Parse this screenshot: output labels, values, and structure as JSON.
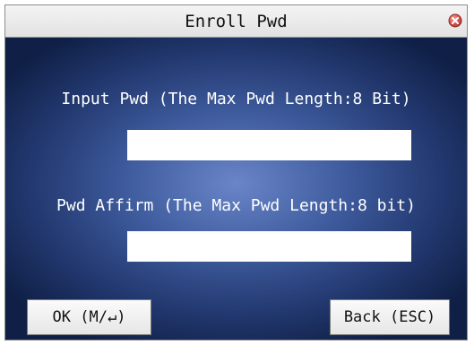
{
  "window": {
    "title": "Enroll Pwd",
    "close_icon": "close-circle-icon"
  },
  "form": {
    "password_label": "Input Pwd (The Max Pwd Length:8 Bit)",
    "password_value": "",
    "affirm_label": "Pwd Affirm (The Max Pwd Length:8 bit)",
    "affirm_value": ""
  },
  "buttons": {
    "ok_label": "OK (M/↵)",
    "back_label": "Back (ESC)"
  },
  "colors": {
    "background_center": "#6a86c8",
    "background_edge": "#0f1f45",
    "close_icon": "#d9534f"
  }
}
